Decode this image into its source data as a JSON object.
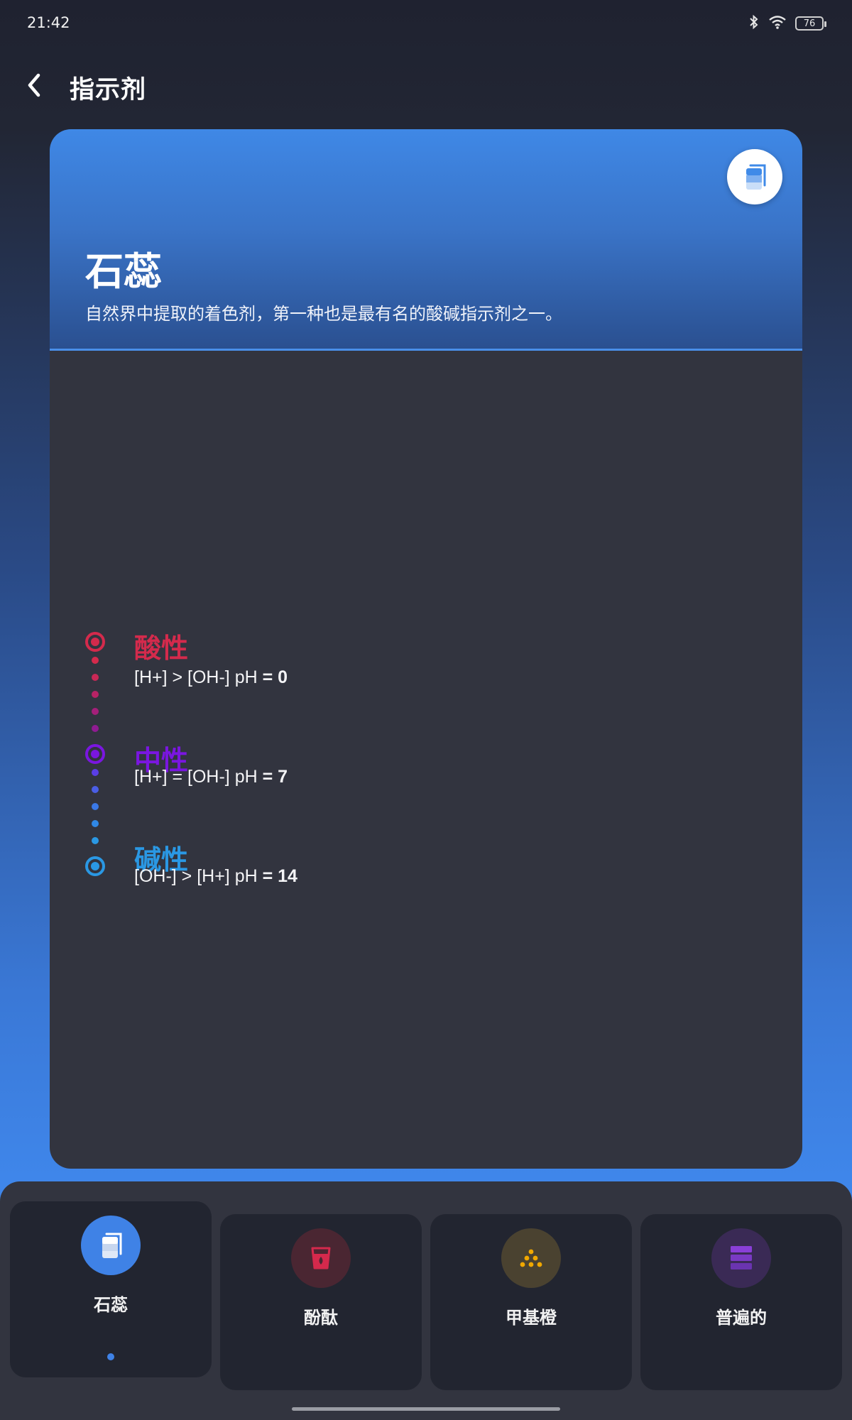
{
  "status_bar": {
    "time": "21:42",
    "battery": "76",
    "icons": [
      "bluetooth-icon",
      "wifi-icon",
      "battery-icon"
    ]
  },
  "header": {
    "title": "指示剂",
    "back_icon": "chevron-left-icon"
  },
  "card": {
    "title": "石蕊",
    "description": "自然界中提取的着色剂，第一种也是最有名的酸碱指示剂之一。",
    "hero_icon": "beaker-layers-icon",
    "accent_color": "#3f88e6"
  },
  "timeline": [
    {
      "label": "酸性",
      "formula_prefix": "[H+] > [OH-] pH ",
      "formula_value": "= 0",
      "color": "#d42a4c"
    },
    {
      "label": "中性",
      "formula_prefix": "[H+] = [OH-] pH ",
      "formula_value": "= 7",
      "color": "#7a16e0"
    },
    {
      "label": "碱性",
      "formula_prefix": "[OH-] > [H+] pH ",
      "formula_value": "= 14",
      "color": "#2a98e4"
    }
  ],
  "bottom_nav": {
    "items": [
      {
        "label": "石蕊",
        "icon": "beaker-layers-icon",
        "selected": true,
        "color": "#3f82e6"
      },
      {
        "label": "酚酞",
        "icon": "cup-drop-icon",
        "selected": false,
        "color": "#d4294c"
      },
      {
        "label": "甲基橙",
        "icon": "dots-pyramid-icon",
        "selected": false,
        "color": "#f0a800"
      },
      {
        "label": "普遍的",
        "icon": "stacked-bars-icon",
        "selected": false,
        "color": "#8a3fd8"
      }
    ]
  }
}
